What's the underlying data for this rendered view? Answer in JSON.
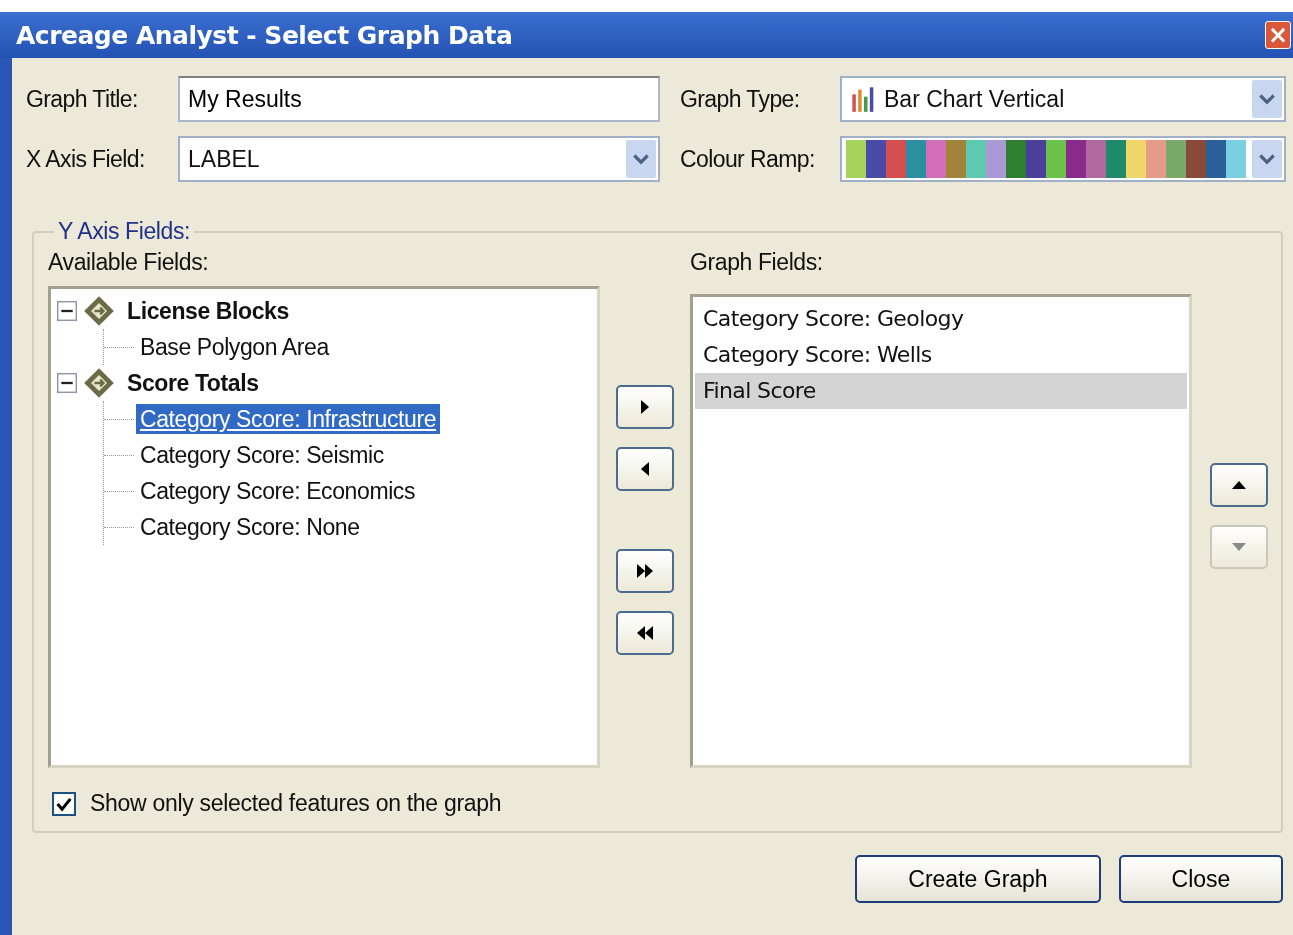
{
  "window": {
    "title": "Acreage Analyst - Select Graph Data",
    "close": "×"
  },
  "graph_title": {
    "label": "Graph Title:",
    "value": "My Results"
  },
  "x_axis_field": {
    "label": "X Axis Field:",
    "value": "LABEL"
  },
  "graph_type": {
    "label": "Graph Type:",
    "value": "Bar Chart Vertical"
  },
  "colour_ramp": {
    "label": "Colour Ramp:",
    "swatches": [
      {
        "color": "#a6d35a"
      },
      {
        "color": "#4a4aa8"
      },
      {
        "color": "#d64f4f"
      },
      {
        "color": "#2a8fa0"
      },
      {
        "color": "#d36fb8"
      },
      {
        "color": "#a0843a"
      },
      {
        "color": "#5ec9b0"
      },
      {
        "color": "#a99ad6"
      },
      {
        "color": "#2f7f2f"
      },
      {
        "color": "#4a3f9a"
      },
      {
        "color": "#6cc24a"
      },
      {
        "color": "#8a2a8a"
      },
      {
        "color": "#b06aa0"
      },
      {
        "color": "#1f8a6a"
      },
      {
        "color": "#f2d56a"
      },
      {
        "color": "#e59a8a"
      },
      {
        "color": "#7aaa6a"
      },
      {
        "color": "#8a4a3a"
      },
      {
        "color": "#2a5f9a"
      },
      {
        "color": "#7ad0e0"
      }
    ]
  },
  "y_axis_fields": {
    "legend": "Y Axis Fields:",
    "available": {
      "label": "Available Fields:",
      "tree": [
        {
          "label": "License Blocks",
          "expanded": true,
          "selected": false,
          "children": [
            {
              "label": "Base Polygon Area",
              "selected": false
            }
          ]
        },
        {
          "label": "Score Totals",
          "expanded": true,
          "selected": false,
          "children": [
            {
              "label": "Category Score: Infrastructure",
              "selected": true
            },
            {
              "label": "Category Score: Seismic",
              "selected": false
            },
            {
              "label": "Category Score: Economics",
              "selected": false
            },
            {
              "label": "Category Score: None",
              "selected": false
            }
          ]
        }
      ]
    },
    "move_buttons": [
      {
        "kind": "add",
        "disabled": false
      },
      {
        "kind": "remove",
        "disabled": false
      },
      {
        "kind": "add_all",
        "disabled": false
      },
      {
        "kind": "remove_all",
        "disabled": false
      }
    ],
    "graph": {
      "label": "Graph Fields:",
      "items": [
        {
          "label": "Category Score: Geology",
          "selected": false
        },
        {
          "label": "Category Score: Wells",
          "selected": false
        },
        {
          "label": "Final Score",
          "selected": true
        }
      ]
    },
    "order_buttons": [
      {
        "kind": "up",
        "disabled": false
      },
      {
        "kind": "down",
        "disabled": true
      }
    ],
    "show_selected": {
      "label": "Show only selected features on the graph",
      "checked": true
    }
  },
  "buttons": [
    {
      "label": "Create Graph"
    },
    {
      "label": "Close"
    }
  ]
}
